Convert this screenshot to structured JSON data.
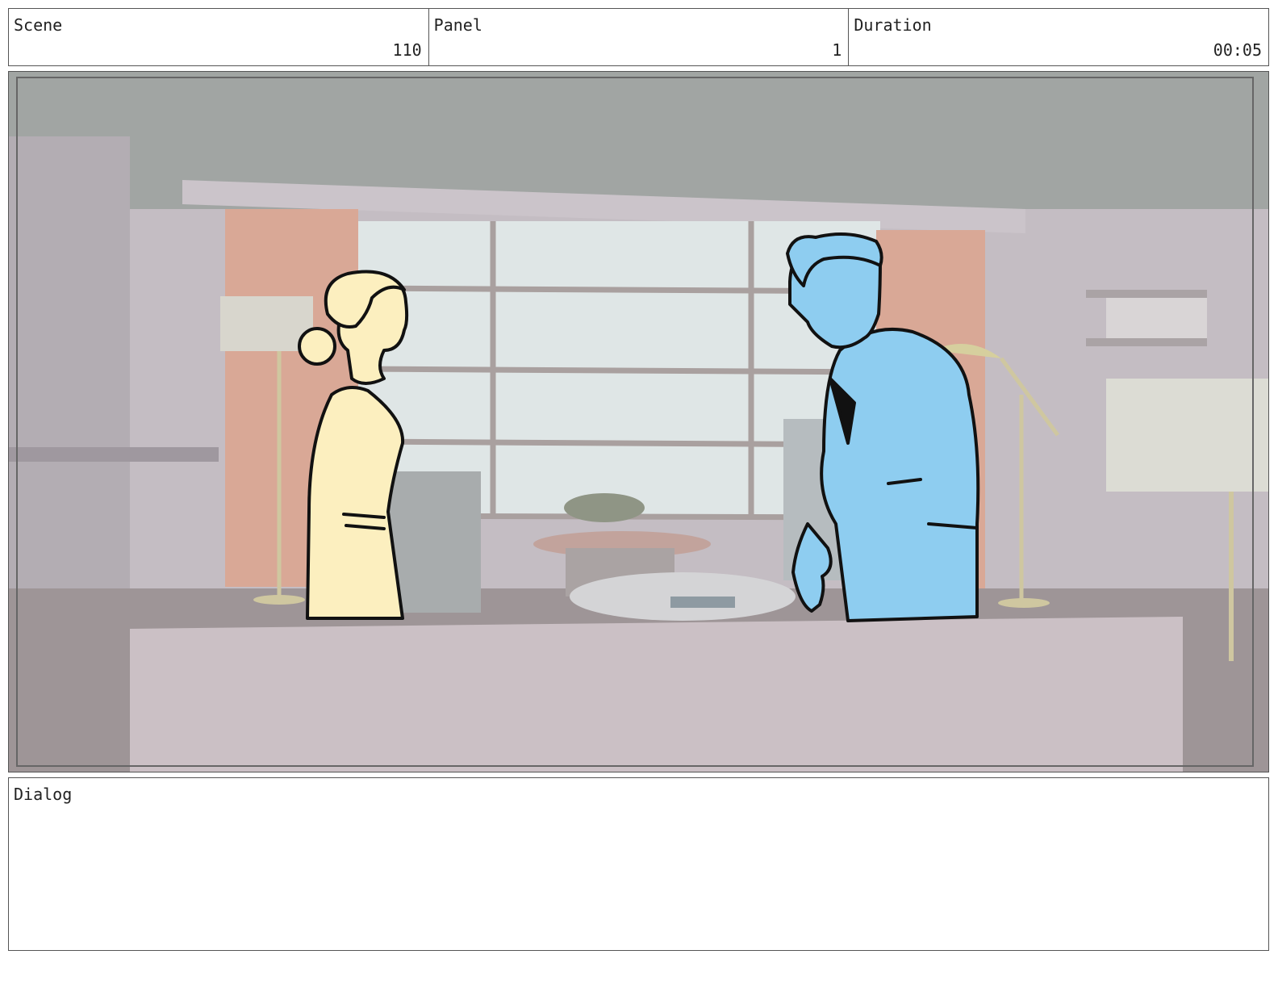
{
  "header": {
    "scene_label": "Scene",
    "scene_value": "110",
    "panel_label": "Panel",
    "panel_value": "1",
    "duration_label": "Duration",
    "duration_value": "00:05"
  },
  "dialog": {
    "label": "Dialog",
    "text": ""
  },
  "colors": {
    "figure_left_fill": "#fcefbf",
    "figure_right_fill": "#8ecdf0",
    "background_tint": "#cfc6cc",
    "outline": "#111111"
  }
}
